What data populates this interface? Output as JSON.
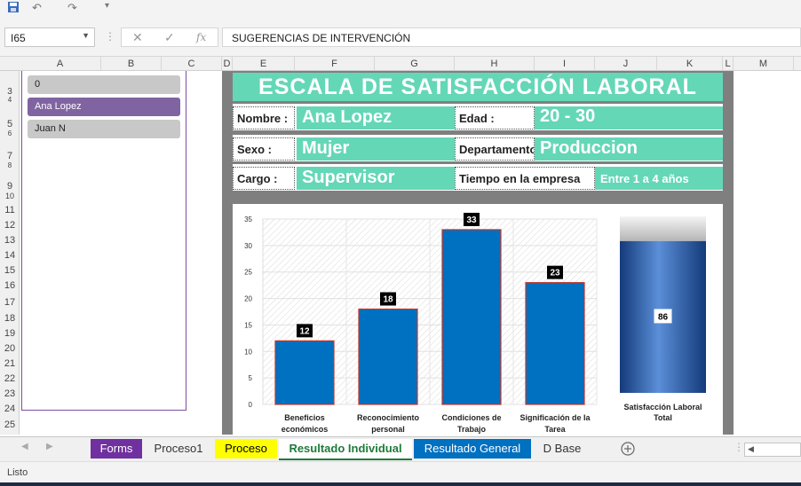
{
  "formula_bar": {
    "name_box": "I65",
    "formula": "SUGERENCIAS DE INTERVENCIÓN"
  },
  "columns": [
    "A",
    "B",
    "C",
    "D",
    "E",
    "F",
    "G",
    "H",
    "I",
    "J",
    "K",
    "L",
    "M"
  ],
  "rows": [
    "3",
    "4",
    "5",
    "6",
    "7",
    "8",
    "9",
    "10",
    "11",
    "12",
    "13",
    "14",
    "15",
    "16",
    "17",
    "18",
    "19",
    "20",
    "21",
    "22",
    "23",
    "24",
    "25"
  ],
  "slicer": {
    "items": [
      {
        "label": "0",
        "selected": false
      },
      {
        "label": "Ana Lopez",
        "selected": true
      },
      {
        "label": "Juan N",
        "selected": false
      }
    ]
  },
  "dashboard": {
    "title": "ESCALA DE SATISFACCIÓN LABORAL",
    "nombre_label": "Nombre :",
    "nombre_value": "Ana Lopez",
    "edad_label": "Edad :",
    "edad_value": "20 - 30",
    "sexo_label": "Sexo :",
    "sexo_value": "Mujer",
    "departamento_label": "Departamento",
    "departamento_value": "Produccion",
    "cargo_label": "Cargo :",
    "cargo_value": "Supervisor",
    "tiempo_label": "Tiempo en la empresa",
    "tiempo_value": "Entre 1 a 4 años"
  },
  "chart_data": [
    {
      "type": "bar",
      "categories": [
        "Beneficios económicos",
        "Reconocimiento personal",
        "Condiciones de Trabajo",
        "Significación de la Tarea"
      ],
      "values": [
        12,
        18,
        33,
        23
      ],
      "ylim": [
        0,
        35
      ],
      "yticks": [
        0,
        5,
        10,
        15,
        20,
        25,
        30,
        35
      ],
      "grid": true,
      "colors": {
        "bar": "#0070c0",
        "bar_border": "#c0392b",
        "label_bg": "#000000"
      }
    },
    {
      "type": "bar",
      "categories": [
        "Satisfacción Laboral Total"
      ],
      "values": [
        86
      ],
      "ylim": [
        0,
        100
      ],
      "colors": {
        "fill": "#2f65b5",
        "empty": "#cfcfcf"
      }
    }
  ],
  "sheet_tabs": [
    {
      "label": "Forms",
      "bg": "#7030a0",
      "color": "#ffffff"
    },
    {
      "label": "Proceso1",
      "bg": "#f0f0f0",
      "color": "#333333"
    },
    {
      "label": "Proceso",
      "bg": "#ffff00",
      "color": "#000000"
    },
    {
      "label": "Resultado Individual",
      "bg": "#ffffff",
      "color": "#1e7b3a",
      "active": true
    },
    {
      "label": "Resultado General",
      "bg": "#0070c0",
      "color": "#ffffff"
    },
    {
      "label": "D Base",
      "bg": "#f0f0f0",
      "color": "#333333"
    }
  ],
  "status": {
    "text": "Listo"
  },
  "icons": {
    "save": "save-icon",
    "undo": "undo-icon",
    "redo": "redo-icon",
    "add_sheet": "plus-circle-icon"
  }
}
